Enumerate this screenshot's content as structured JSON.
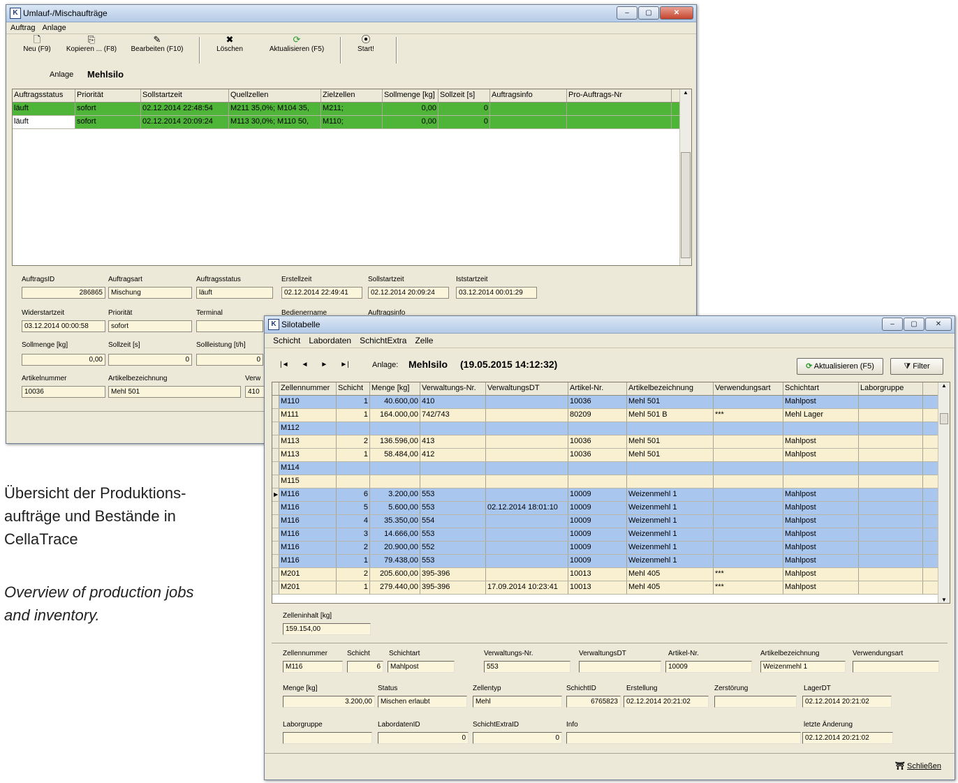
{
  "colors": {
    "running_row": "#4fb539",
    "silo_row_blue": "#a9c6ee",
    "silo_row_cream": "#f8f0d0",
    "field_bg": "#fbf5dc"
  },
  "win1": {
    "title": "Umlauf-/Mischaufträge",
    "menu": [
      "Auftrag",
      "Anlage"
    ],
    "toolbar": [
      {
        "label": "Neu (F9)",
        "icon": "new-document-icon"
      },
      {
        "label": "Kopieren ... (F8)",
        "icon": "copy-icon"
      },
      {
        "label": "Bearbeiten (F10)",
        "icon": "edit-icon"
      },
      {
        "label": "Löschen",
        "icon": "delete-icon"
      },
      {
        "label": "Aktualisieren (F5)",
        "icon": "refresh-icon"
      },
      {
        "label": "Start!",
        "icon": "start-icon"
      }
    ],
    "anlage_label": "Anlage",
    "anlage_value": "Mehlsilo",
    "columns": [
      "Auftragsstatus",
      "Priorität",
      "Sollstartzeit",
      "Quellzellen",
      "Zielzellen",
      "Sollmenge [kg]",
      "Sollzeit [s]",
      "Auftragsinfo",
      "Pro-Auftrags-Nr"
    ],
    "rows": [
      [
        "läuft",
        "sofort",
        "02.12.2014 22:48:54",
        "M211 35,0%; M104 35,",
        "M211;",
        "0,00",
        "0",
        "",
        ""
      ],
      [
        "läuft",
        "sofort",
        "02.12.2014 20:09:24",
        "M113 30,0%; M110 50,",
        "M110;",
        "0,00",
        "0",
        "",
        ""
      ]
    ],
    "details": {
      "auftragsid_label": "AuftragsID",
      "auftragsid": "286865",
      "auftragsart_label": "Auftragsart",
      "auftragsart": "Mischung",
      "auftragsstatus_label": "Auftragsstatus",
      "auftragsstatus": "läuft",
      "erstellzeit_label": "Erstellzeit",
      "erstellzeit": "02.12.2014 22:49:41",
      "sollstartzeit_label": "Sollstartzeit",
      "sollstartzeit": "02.12.2014 20:09:24",
      "iststartzeit_label": "Iststartzeit",
      "iststartzeit": "03.12.2014 00:01:29",
      "widerstartzeit_label": "Widerstartzeit",
      "widerstartzeit": "03.12.2014 00:00:58",
      "prioritaet_label": "Priorität",
      "prioritaet": "sofort",
      "terminal_label": "Terminal",
      "terminal": "",
      "bedienername_label": "Bedienername",
      "auftragsinfo_label": "Auftragsinfo",
      "sollmenge_label": "Sollmenge [kg]",
      "sollmenge": "0,00",
      "sollzeit_label": "Sollzeit [s]",
      "sollzeit": "0",
      "sollleistung_label": "Sollleistung [t/h]",
      "sollleistung": "0",
      "artikelnummer_label": "Artikelnummer",
      "artikelnummer": "10036",
      "artikelbezeichnung_label": "Artikelbezeichnung",
      "artikelbezeichnung": "Mehl 501",
      "verw_label": "Verw",
      "verw": "410"
    }
  },
  "win2": {
    "title": "Silotabelle",
    "menu": [
      "Schicht",
      "Labordaten",
      "SchichtExtra",
      "Zelle"
    ],
    "nav": [
      "|◄",
      "◄",
      "►",
      "►|"
    ],
    "anlage_label": "Anlage:",
    "anlage_value": "Mehlsilo",
    "timestamp": "(19.05.2015 14:12:32)",
    "refresh_button": "Aktualisieren (F5)",
    "filter_button": "Filter",
    "columns": [
      "Zellennummer",
      "Schicht",
      "Menge [kg]",
      "Verwaltungs-Nr.",
      "VerwaltungsDT",
      "Artikel-Nr.",
      "Artikelbezeichnung",
      "Verwendungsart",
      "Schichtart",
      "Laborgruppe"
    ],
    "rows": [
      {
        "c": "b",
        "v": [
          "M110",
          "1",
          "40.600,00",
          "410",
          "",
          "10036",
          "Mehl 501",
          "",
          "Mahlpost",
          ""
        ]
      },
      {
        "c": "y",
        "v": [
          "M111",
          "1",
          "164.000,00",
          "742/743",
          "",
          "80209",
          "Mehl 501 B",
          "***",
          "Mehl Lager",
          ""
        ]
      },
      {
        "c": "b",
        "v": [
          "M112",
          "",
          "",
          "",
          "",
          "",
          "",
          "",
          "",
          ""
        ]
      },
      {
        "c": "y",
        "v": [
          "M113",
          "2",
          "136.596,00",
          "413",
          "",
          "10036",
          "Mehl 501",
          "",
          "Mahlpost",
          ""
        ]
      },
      {
        "c": "y",
        "v": [
          "M113",
          "1",
          "58.484,00",
          "412",
          "",
          "10036",
          "Mehl 501",
          "",
          "Mahlpost",
          ""
        ]
      },
      {
        "c": "b",
        "v": [
          "M114",
          "",
          "",
          "",
          "",
          "",
          "",
          "",
          "",
          ""
        ]
      },
      {
        "c": "y",
        "v": [
          "M115",
          "",
          "",
          "",
          "",
          "",
          "",
          "",
          "",
          ""
        ]
      },
      {
        "c": "b",
        "v": [
          "M116",
          "6",
          "3.200,00",
          "553",
          "",
          "10009",
          "Weizenmehl 1",
          "",
          "Mahlpost",
          ""
        ]
      },
      {
        "c": "b",
        "v": [
          "M116",
          "5",
          "5.600,00",
          "553",
          "02.12.2014 18:01:10",
          "10009",
          "Weizenmehl 1",
          "",
          "Mahlpost",
          ""
        ]
      },
      {
        "c": "b",
        "v": [
          "M116",
          "4",
          "35.350,00",
          "554",
          "",
          "10009",
          "Weizenmehl 1",
          "",
          "Mahlpost",
          ""
        ]
      },
      {
        "c": "b",
        "v": [
          "M116",
          "3",
          "14.666,00",
          "553",
          "",
          "10009",
          "Weizenmehl 1",
          "",
          "Mahlpost",
          ""
        ]
      },
      {
        "c": "b",
        "v": [
          "M116",
          "2",
          "20.900,00",
          "552",
          "",
          "10009",
          "Weizenmehl 1",
          "",
          "Mahlpost",
          ""
        ]
      },
      {
        "c": "b",
        "v": [
          "M116",
          "1",
          "79.438,00",
          "553",
          "",
          "10009",
          "Weizenmehl 1",
          "",
          "Mahlpost",
          ""
        ]
      },
      {
        "c": "y",
        "v": [
          "M201",
          "2",
          "205.600,00",
          "395-396",
          "",
          "10013",
          "Mehl 405",
          "***",
          "Mahlpost",
          ""
        ]
      },
      {
        "c": "y",
        "v": [
          "M201",
          "1",
          "279.440,00",
          "395-396",
          "17.09.2014 10:23:41",
          "10013",
          "Mehl 405",
          "***",
          "Mahlpost",
          ""
        ]
      }
    ],
    "zelleninhalt_label": "Zelleninhalt [kg]",
    "zelleninhalt": "159.154,00",
    "detail": {
      "zellennummer_label": "Zellennummer",
      "zellennummer": "M116",
      "schicht_label": "Schicht",
      "schicht": "6",
      "schichtart_label": "Schichtart",
      "schichtart": "Mahlpost",
      "verwaltungsnr_label": "Verwaltungs-Nr.",
      "verwaltungsnr": "553",
      "verwaltungsdt_label": "VerwaltungsDT",
      "verwaltungsdt": "",
      "artikelnr_label": "Artikel-Nr.",
      "artikelnr": "10009",
      "artikelbezeichnung_label": "Artikelbezeichnung",
      "artikelbezeichnung": "Weizenmehl 1",
      "verwendungsart_label": "Verwendungsart",
      "verwendungsart": "",
      "menge_label": "Menge [kg]",
      "menge": "3.200,00",
      "status_label": "Status",
      "status": "Mischen erlaubt",
      "zellentyp_label": "Zellentyp",
      "zellentyp": "Mehl",
      "schichtid_label": "SchichtID",
      "schichtid": "6765823",
      "erstellung_label": "Erstellung",
      "erstellung": "02.12.2014 20:21:02",
      "zerstoerung_label": "Zerstörung",
      "zerstoerung": "",
      "lagerdt_label": "LagerDT",
      "lagerdt": "02.12.2014 20:21:02",
      "laborgruppe_label": "Laborgruppe",
      "laborgruppe": "",
      "labordatenid_label": "LabordatenID",
      "labordatenid": "0",
      "schichtextraid_label": "SchichtExtraID",
      "schichtextraid": "0",
      "info_label": "Info",
      "info": "",
      "letzteaenderung_label": "letzte Änderung",
      "letzteaenderung": "02.12.2014 20:21:02"
    },
    "close_button": "Schließen"
  },
  "caption": {
    "de_line1": "Übersicht der Produktions-",
    "de_line2": "aufträge und Bestände in",
    "de_line3": "CellaTrace",
    "en_line1": "Overview of production jobs",
    "en_line2": "and inventory."
  }
}
